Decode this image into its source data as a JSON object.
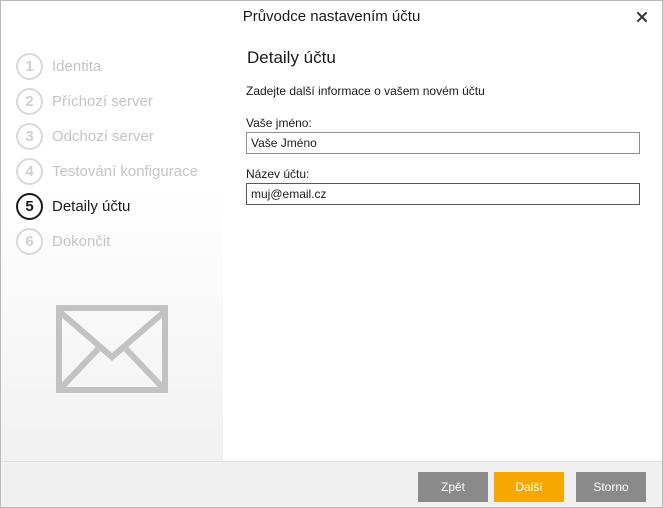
{
  "window": {
    "title": "Průvodce nastavením účtu"
  },
  "sidebar": {
    "steps": [
      {
        "number": "1",
        "label": "Identita",
        "active": false
      },
      {
        "number": "2",
        "label": "Příchozí server",
        "active": false
      },
      {
        "number": "3",
        "label": "Odchozí server",
        "active": false
      },
      {
        "number": "4",
        "label": "Testování konfigurace",
        "active": false
      },
      {
        "number": "5",
        "label": "Detaily účtu",
        "active": true
      },
      {
        "number": "6",
        "label": "Dokončit",
        "active": false
      }
    ],
    "illustration_icon": "envelope-icon"
  },
  "main": {
    "title": "Detaily účtu",
    "intro": "Zadejte další informace o vašem novém účtu",
    "name_label": "Vaše jméno:",
    "name_value": "Vaše Jméno",
    "account_label": "Název účtu:",
    "account_value": "muj@email.cz"
  },
  "footer": {
    "back_label": "Zpět",
    "next_label": "Další",
    "cancel_label": "Storno"
  },
  "colors": {
    "primary_button": "#f7a800",
    "secondary_button": "#8a8a8a",
    "inactive_step": "#c4c4c4",
    "active_step": "#1a1a1a"
  }
}
